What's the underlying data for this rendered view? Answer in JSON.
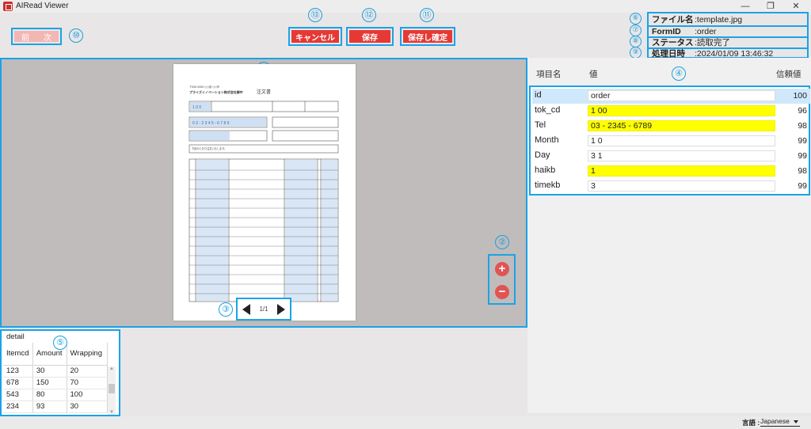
{
  "window": {
    "title": "AIRead Viewer",
    "min_glyph": "—",
    "restore_glyph": "❐",
    "close_glyph": "✕"
  },
  "toolbar": {
    "prev_label": "前",
    "next_label": "次",
    "cancel_label": "キャンセル",
    "save_label": "保存",
    "save_confirm_label": "保存し確定"
  },
  "info": {
    "filename_label": "ファイル名",
    "filename_value": ":template.jpg",
    "formid_label": "FormID",
    "formid_value": ":order",
    "status_label": "ステータス",
    "status_value": ":読取完了",
    "datetime_label": "処理日時",
    "datetime_value": ":2024/01/09 13:46:32"
  },
  "viewer": {
    "page_indicator": "1/1",
    "zoom_in_glyph": "+",
    "zoom_out_glyph": "−"
  },
  "document": {
    "title": "注文書",
    "company": "プライズイノベーション株式会社御中",
    "tok_cd": "1 0 0",
    "tel": "0 3 - 2 3 4 5 - 6 7 8 9",
    "remark": "下記のとおり注文いたします。"
  },
  "fields": {
    "col_name": "項目名",
    "col_value": "値",
    "col_confidence": "信頼値",
    "rows": [
      {
        "name": "id",
        "value": "order",
        "confidence": "100",
        "highlight": false,
        "selected": true
      },
      {
        "name": "tok_cd",
        "value": "1 00",
        "confidence": "96",
        "highlight": true,
        "selected": false
      },
      {
        "name": "Tel",
        "value": "03 - 2345 - 6789",
        "confidence": "98",
        "highlight": true,
        "selected": false
      },
      {
        "name": "Month",
        "value": "1 0",
        "confidence": "99",
        "highlight": false,
        "selected": false
      },
      {
        "name": "Day",
        "value": "3 1",
        "confidence": "99",
        "highlight": false,
        "selected": false
      },
      {
        "name": "haikb",
        "value": "1",
        "confidence": "98",
        "highlight": true,
        "selected": false
      },
      {
        "name": "timekb",
        "value": "3",
        "confidence": "99",
        "highlight": false,
        "selected": false
      }
    ]
  },
  "detail": {
    "tab_label": "detail",
    "columns": [
      "Itemcd",
      "Amount",
      "Wrapping"
    ],
    "rows": [
      [
        "123",
        "30",
        "20"
      ],
      [
        "678",
        "150",
        "70"
      ],
      [
        "543",
        "80",
        "100"
      ],
      [
        "234",
        "93",
        "30"
      ]
    ]
  },
  "status_bar": {
    "language_label": "言語 :",
    "language_value": "Japanese"
  },
  "annotations": [
    "①",
    "②",
    "③",
    "④",
    "⑤",
    "⑥",
    "⑦",
    "⑧",
    "⑨",
    "⑩",
    "⑪",
    "⑫",
    "⑬"
  ],
  "colors": {
    "accent_blue": "#1aa3e8",
    "button_red": "#e53935",
    "highlight_yellow": "#ffff00",
    "selected_row": "#cfe8fb"
  }
}
